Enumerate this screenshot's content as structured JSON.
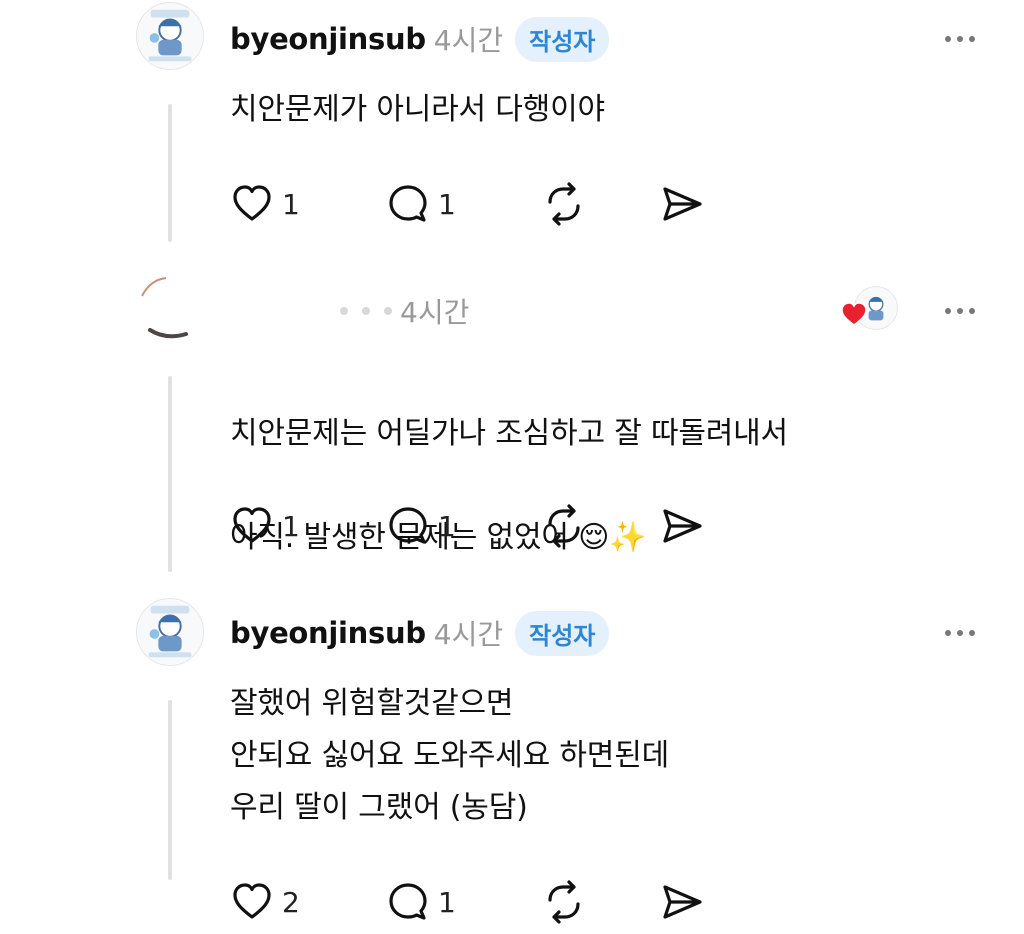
{
  "comments": [
    {
      "username": "byeonjinsub",
      "time": "4시간",
      "badge": "작성자",
      "text": "치안문제가 아니라서 다행이야",
      "likes": "1",
      "replies": "1"
    },
    {
      "username": "",
      "time": "4시간",
      "text_line1": "치안문제는 어딜가나 조심하고 잘 따돌려내서",
      "text_line2": "아직. 발생한 문제는 없었어 😌✨",
      "likes": "1",
      "replies": "1"
    },
    {
      "username": "byeonjinsub",
      "time": "4시간",
      "badge": "작성자",
      "text": "잘했어 위험할것같으면\n안되요 싫어요  도와주세요 하면된데\n우리 딸이 그랬어 (농담)",
      "likes": "2",
      "replies": "1"
    }
  ],
  "icons": {
    "like": "heart-icon",
    "reply": "comment-icon",
    "repost": "repost-icon",
    "share": "send-icon",
    "more": "more-dots-icon"
  },
  "colors": {
    "badge_bg": "#e4f0fb",
    "badge_text": "#2d86d3",
    "heart_red": "#e8202f",
    "muted": "#999999"
  }
}
